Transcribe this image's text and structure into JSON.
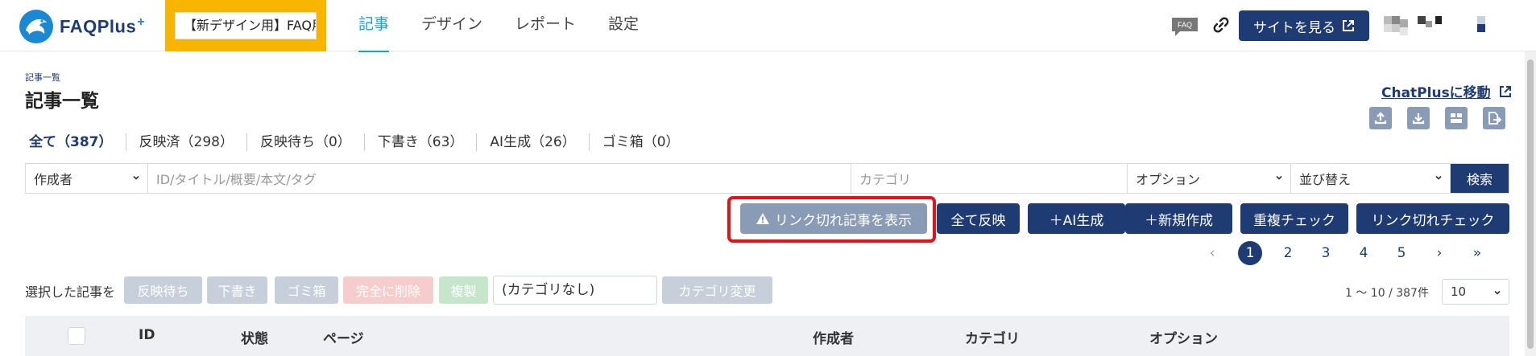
{
  "header": {
    "logo_text": "FAQPlus",
    "logo_plus": "+",
    "site_name": "【新デザイン用】FAQ用",
    "nav": [
      {
        "label": "記事",
        "active": true
      },
      {
        "label": "デザイン",
        "active": false
      },
      {
        "label": "レポート",
        "active": false
      },
      {
        "label": "設定",
        "active": false
      }
    ],
    "faq_badge": "FAQ",
    "view_site_label": "サイトを見る"
  },
  "page": {
    "breadcrumb": "記事一覧",
    "title": "記事一覧",
    "chatplus_link": "ChatPlusに移動"
  },
  "tabs": [
    {
      "label": "全て（387）",
      "active": true
    },
    {
      "label": "反映済（298）",
      "active": false
    },
    {
      "label": "反映待ち（0）",
      "active": false
    },
    {
      "label": "下書き（63）",
      "active": false
    },
    {
      "label": "AI生成（26）",
      "active": false
    },
    {
      "label": "ゴミ箱（0）",
      "active": false
    }
  ],
  "filters": {
    "author": "作成者",
    "keyword_placeholder": "ID/タイトル/概要/本文/タグ",
    "category_placeholder": "カテゴリ",
    "option": "オプション",
    "sort": "並び替え",
    "search_label": "検索"
  },
  "actions": {
    "broken_link_articles": "リンク切れ記事を表示",
    "publish_all": "全て反映",
    "ai_generate": "＋AI生成",
    "new_article": "＋新規作成",
    "duplicate_check": "重複チェック",
    "broken_link_check": "リンク切れチェック"
  },
  "pagination": {
    "prev": "‹",
    "pages": [
      "1",
      "2",
      "3",
      "4",
      "5"
    ],
    "current": "1",
    "next": "›",
    "last": "»"
  },
  "bulk": {
    "label": "選択した記事を",
    "pending": "反映待ち",
    "draft": "下書き",
    "trash": "ゴミ箱",
    "delete": "完全に削除",
    "copy": "複製",
    "category_value": "(カテゴリなし)",
    "category_change": "カテゴリ変更"
  },
  "listing": {
    "count_text": "1 ～ 10 / 387件",
    "per_page": "10"
  },
  "table_headers": {
    "id": "ID",
    "status": "状態",
    "page": "ページ",
    "author": "作成者",
    "category": "カテゴリ",
    "option": "オプション"
  },
  "colors": {
    "primary": "#1f3b73",
    "accent": "#1c9fd6",
    "highlight_site": "#f7b500",
    "alert_outline": "#e0141a",
    "muted_button": "#8a9bb5"
  }
}
